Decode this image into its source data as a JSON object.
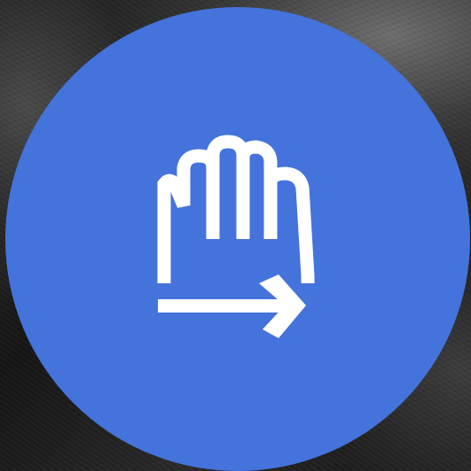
{
  "badge": {
    "background_color": "#4473dc",
    "icon_color": "#ffffff",
    "icon": "hand-swipe-right-icon"
  }
}
